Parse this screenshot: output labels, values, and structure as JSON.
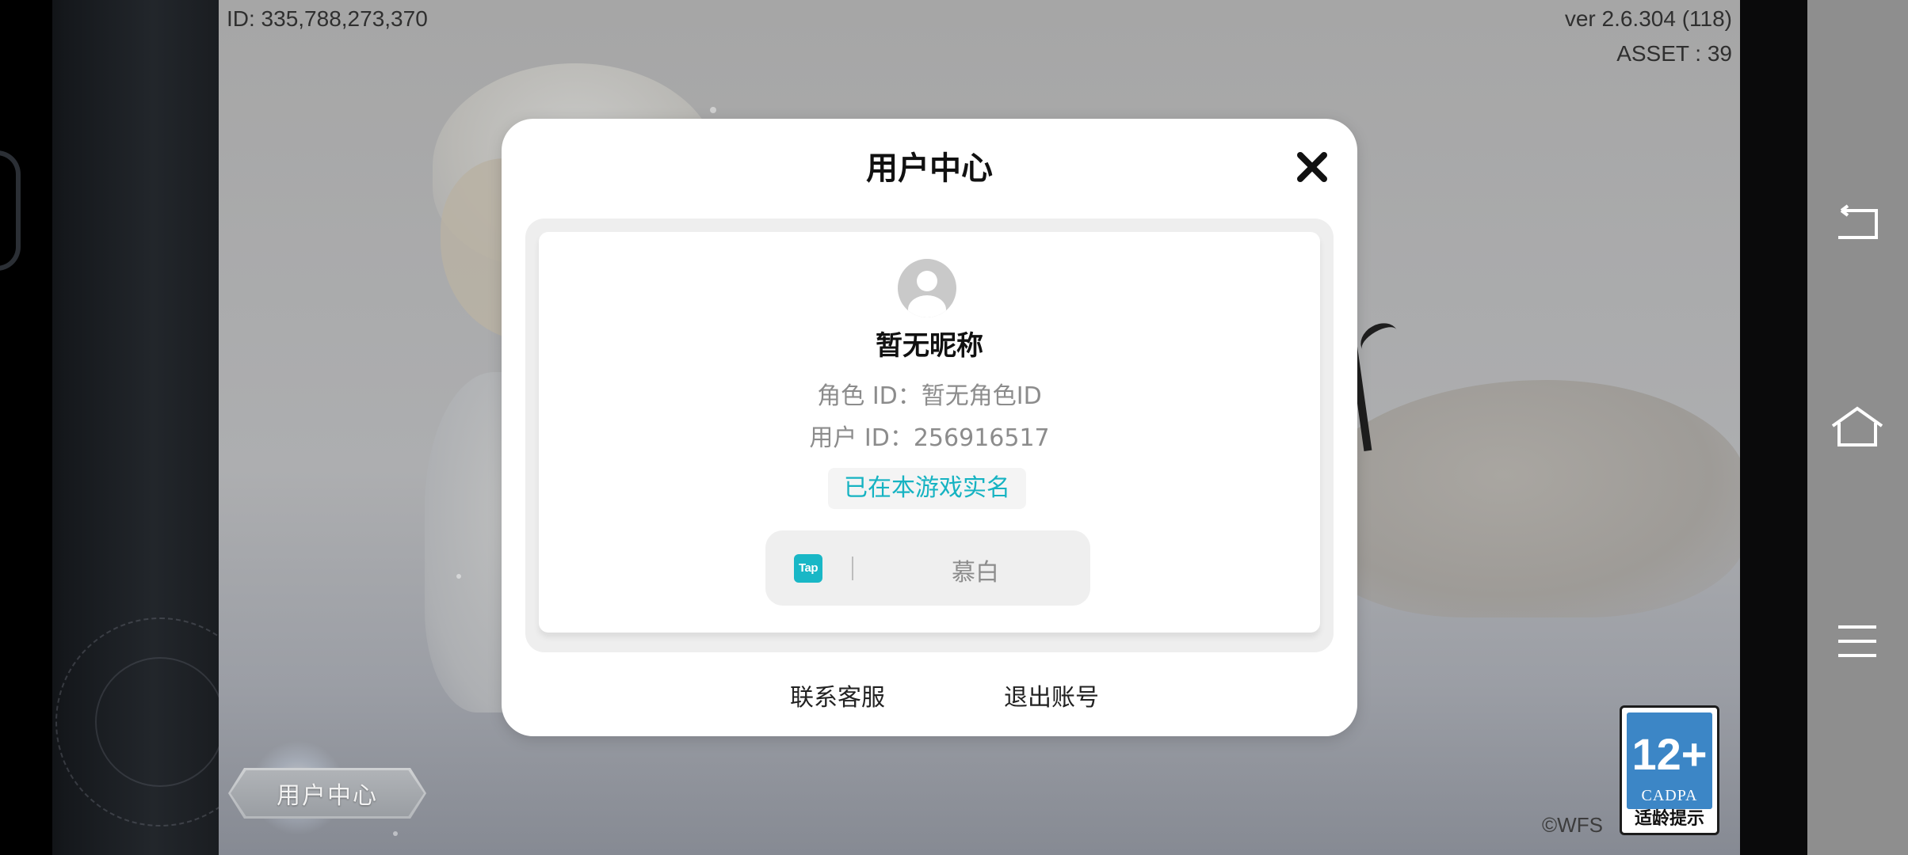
{
  "hud": {
    "player_id": "ID: 335,788,273,370",
    "version": "ver 2.6.304 (118)",
    "asset": "ASSET : 39"
  },
  "dialog": {
    "title": "用户中心",
    "nickname": "暂无昵称",
    "role_id": "角色 ID：暂无角色ID",
    "user_id": "用户 ID：256916517",
    "verified": "已在本游戏实名",
    "tap_logo": "Tap",
    "tap_name": "慕白",
    "contact_service": "联系客服",
    "logout": "退出账号"
  },
  "bottom": {
    "user_center_button": "用户中心",
    "copyright": "©WFS"
  },
  "age_badge": {
    "rating": "12+",
    "org": "CADPA",
    "label": "适龄提示",
    "color": "#3c86c6"
  },
  "nav": {
    "icons": [
      "back-icon",
      "home-icon",
      "menu-icon"
    ]
  },
  "colors": {
    "accent": "#16b3c2",
    "tap_brand": "#19b7c6"
  }
}
